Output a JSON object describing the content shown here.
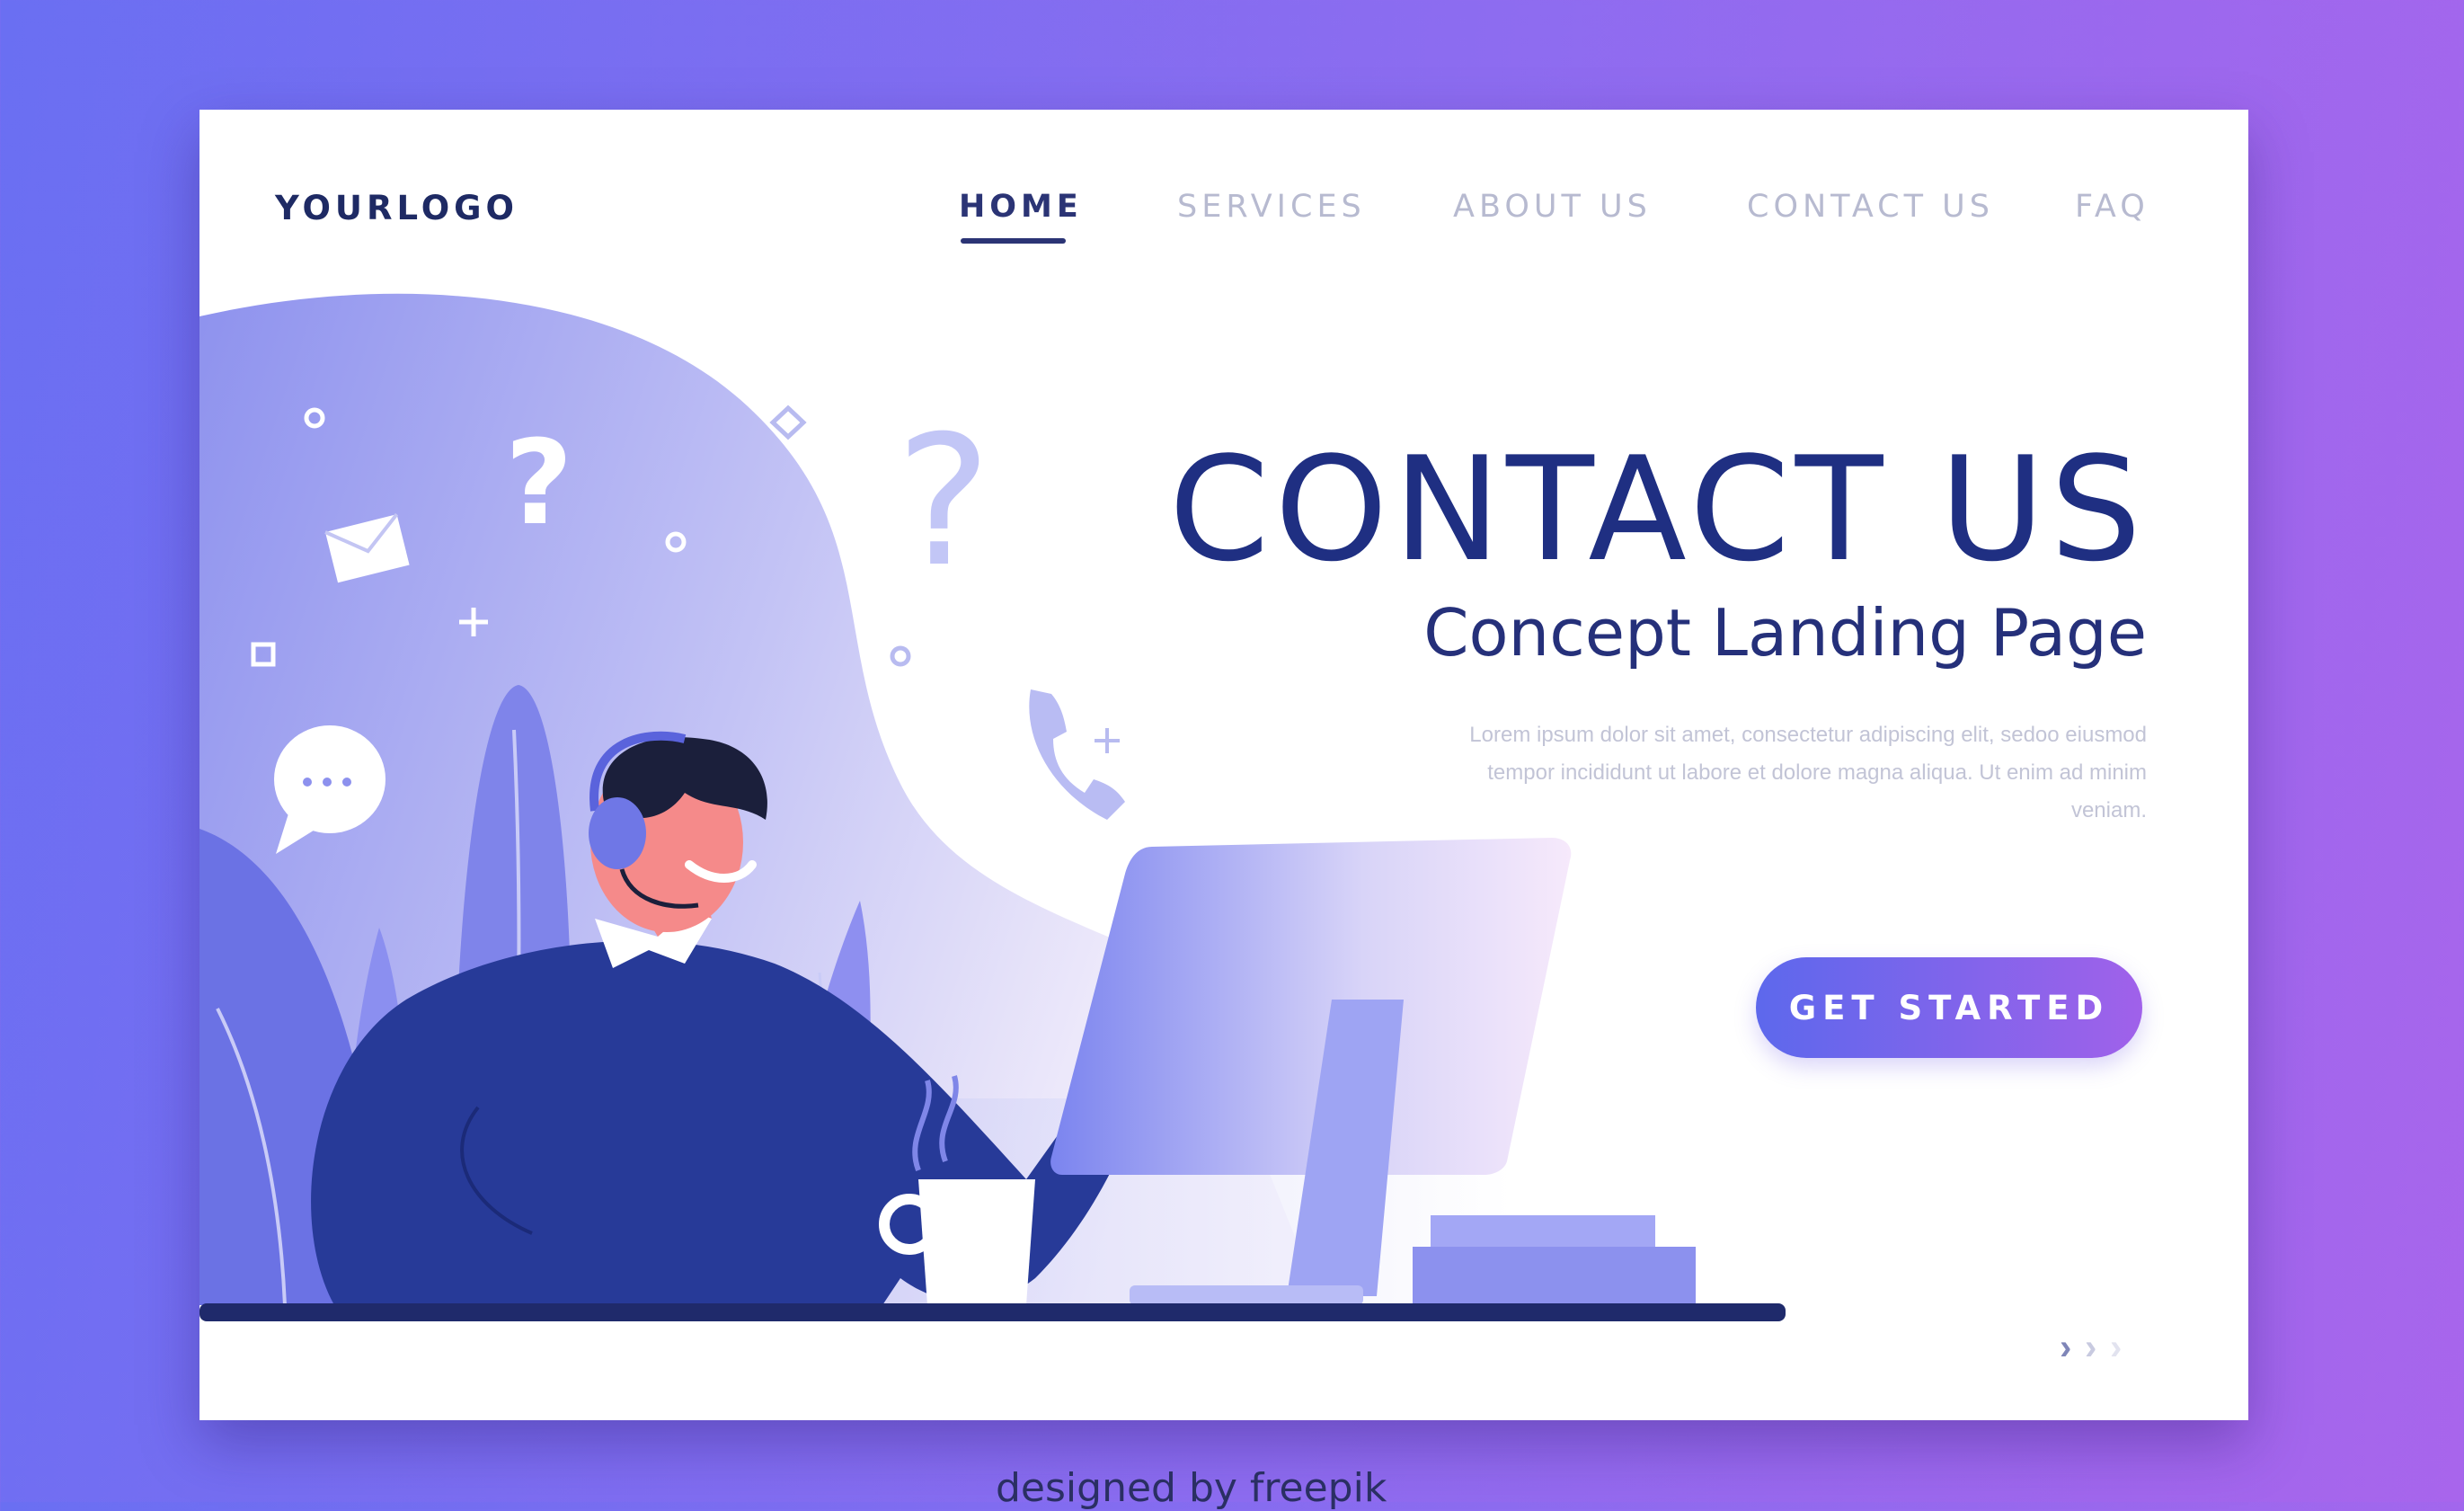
{
  "brand": {
    "logo_text": "YOURLOGO"
  },
  "nav": {
    "items": [
      {
        "label": "HOME",
        "active": true
      },
      {
        "label": "SERVICES",
        "active": false
      },
      {
        "label": "ABOUT US",
        "active": false
      },
      {
        "label": "CONTACT US",
        "active": false
      },
      {
        "label": "FAQ",
        "active": false
      }
    ]
  },
  "hero": {
    "title": "CONTACT US",
    "subtitle": "Concept Landing Page",
    "body": "Lorem ipsum dolor sit amet, consectetur adipiscing elit, sedoo eiusmod tempor incididunt ut labore et dolore magna aliqua. Ut enim ad minim veniam.",
    "cta_label": "GET STARTED"
  },
  "pager": {
    "symbols": [
      "›",
      "›",
      "›"
    ]
  },
  "footer": {
    "credit": "designed by freepik"
  },
  "colors": {
    "background_start": "#6a6ff2",
    "background_end": "#a865ec",
    "brand_navy": "#1f2f82",
    "accent_blue": "#5d68ec",
    "accent_purple": "#a061ea"
  },
  "icons": [
    "envelope-icon",
    "question-mark-icon",
    "chat-bubble-icon",
    "phone-icon",
    "plus-icon",
    "diamond-icon",
    "chevron-right-icon"
  ]
}
